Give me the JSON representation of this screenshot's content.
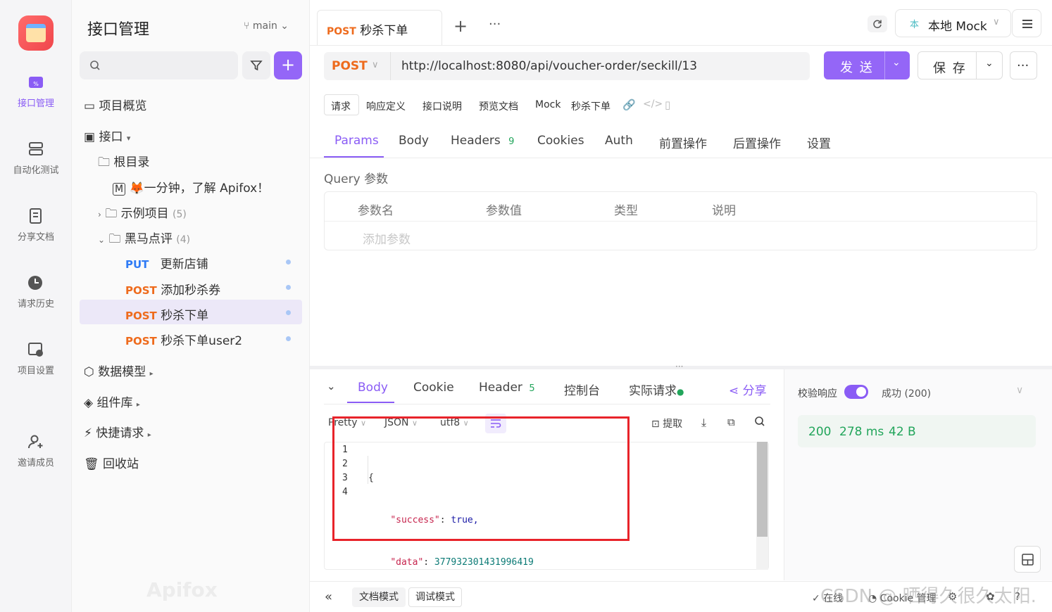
{
  "rail": {
    "items": [
      {
        "label": "接口管理",
        "icon": "api-icon"
      },
      {
        "label": "自动化测试",
        "icon": "automation-icon"
      },
      {
        "label": "分享文档",
        "icon": "share-doc-icon"
      },
      {
        "label": "请求历史",
        "icon": "history-icon"
      },
      {
        "label": "项目设置",
        "icon": "project-settings-icon"
      },
      {
        "label": "邀请成员",
        "icon": "invite-member-icon"
      }
    ]
  },
  "sidebar": {
    "title": "接口管理",
    "branch": "main",
    "tree": {
      "overview": "项目概览",
      "api": "接口",
      "root": "根目录",
      "intro_doc": "一分钟，了解 Apifox！",
      "example_folder": "示例项目",
      "example_count": "(5)",
      "hmdp_folder": "黑马点评",
      "hmdp_count": "(4)",
      "endpoints": [
        {
          "method": "PUT",
          "name": "更新店铺"
        },
        {
          "method": "POST",
          "name": "添加秒杀券"
        },
        {
          "method": "POST",
          "name": "秒杀下单"
        },
        {
          "method": "POST",
          "name": "秒杀下单user2"
        }
      ],
      "data_model": "数据模型",
      "components": "组件库",
      "quick_request": "快捷请求",
      "recycle_bin": "回收站"
    },
    "watermark": "Apifox"
  },
  "tabbar": {
    "tab_method": "POST",
    "tab_name": "秒杀下单",
    "env": "本地 Mock"
  },
  "request": {
    "method": "POST",
    "url": "http://localhost:8080/api/voucher-order/seckill/13",
    "send": "发 送",
    "save": "保 存"
  },
  "subtabs": [
    "请求",
    "响应定义",
    "接口说明",
    "预览文档",
    "Mock",
    "秒杀下单"
  ],
  "param_tabs": [
    {
      "label": "Params"
    },
    {
      "label": "Body"
    },
    {
      "label": "Headers",
      "badge": "9"
    },
    {
      "label": "Cookies"
    },
    {
      "label": "Auth"
    },
    {
      "label": "前置操作"
    },
    {
      "label": "后置操作"
    },
    {
      "label": "设置"
    }
  ],
  "query": {
    "title": "Query 参数",
    "columns": [
      "参数名",
      "参数值",
      "类型",
      "说明"
    ],
    "add_placeholder": "添加参数"
  },
  "response": {
    "tabs": [
      {
        "label": "Body"
      },
      {
        "label": "Cookie"
      },
      {
        "label": "Header",
        "badge": "5"
      },
      {
        "label": "控制台"
      },
      {
        "label": "实际请求"
      }
    ],
    "share": "分享",
    "format": "Pretty",
    "lang": "JSON",
    "encoding": "utf8",
    "extract": "提取",
    "code_lines": [
      {
        "n": "1",
        "text": "{"
      },
      {
        "n": "2",
        "key": "\"success\"",
        "val": " true,"
      },
      {
        "n": "3",
        "key": "\"data\"",
        "val": " 377932301431996419"
      },
      {
        "n": "4",
        "text": "}"
      }
    ],
    "validate_label": "校验响应",
    "validate_result": "成功 (200)",
    "status_code": "200",
    "time": "278 ms",
    "size": "42 B"
  },
  "bottom": {
    "doc_mode": "文档模式",
    "debug_mode": "调试模式",
    "online": "在线",
    "cookie_mgr": "Cookie 管理",
    "watermark": "CSDN @ 晒得久很久太阳."
  },
  "colors": {
    "accent": "#8a5cf5",
    "post": "#ee6b1d",
    "put": "#2f7bf5",
    "success": "#22a55b",
    "highlight_box": "#e8232a"
  }
}
